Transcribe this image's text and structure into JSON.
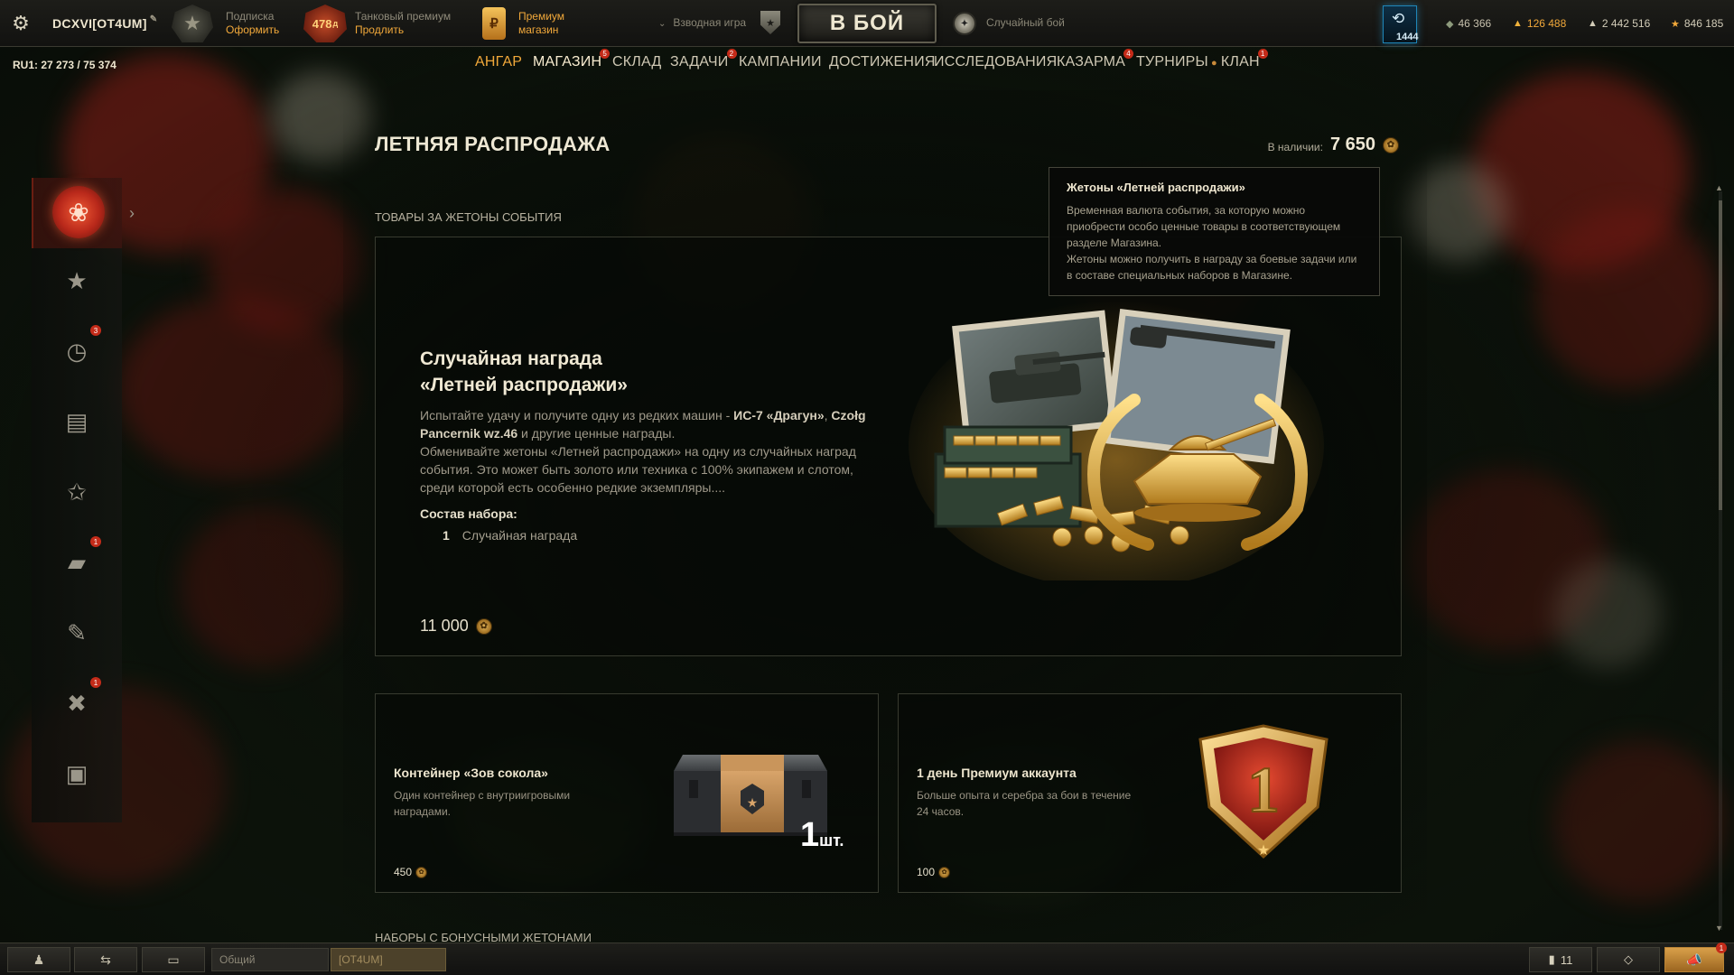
{
  "topbar": {
    "player_name": "DCXVI[OT4UM]",
    "subscription": {
      "line1": "Подписка",
      "line2": "Оформить"
    },
    "premium_tank": {
      "days": "478",
      "suffix": "д",
      "line1": "Танковый премиум",
      "line2": "Продлить"
    },
    "premium_shop": {
      "line1": "Премиум",
      "line2": "магазин"
    },
    "platoon_label": "Взводная игра",
    "battle_button": "В БОЙ",
    "battle_mode": "Случайный бой",
    "notifications_count": "1444",
    "currencies": [
      {
        "name": "bonds",
        "value": "46 366",
        "icon": "bond-icon"
      },
      {
        "name": "gold",
        "value": "126 488",
        "icon": "gold-icon"
      },
      {
        "name": "credits",
        "value": "2 442 516",
        "icon": "credits-icon"
      },
      {
        "name": "free_xp",
        "value": "846 185",
        "icon": "free-xp-icon"
      }
    ]
  },
  "server_online": {
    "server": "RU1:",
    "online": "27 273",
    "separator": "/",
    "total": "75 374"
  },
  "nav": [
    {
      "label": "АНГАР"
    },
    {
      "label": "МАГАЗИН",
      "badge": "5"
    },
    {
      "label": "СКЛАД"
    },
    {
      "label": "ЗАДАЧИ",
      "badge": "2"
    },
    {
      "label": "КАМПАНИИ"
    },
    {
      "label": "ДОСТИЖЕНИЯ"
    },
    {
      "label": "ИССЛЕДОВАНИЯ"
    },
    {
      "label": "КАЗАРМА",
      "badge": "4"
    },
    {
      "label": "ТУРНИРЫ"
    },
    {
      "label": "КЛАН",
      "badge": "1"
    }
  ],
  "sidebar": {
    "items": [
      {
        "icon": "summer-sale-icon"
      },
      {
        "icon": "star-icon"
      },
      {
        "icon": "clock-icon",
        "badge": "3"
      },
      {
        "icon": "bundles-icon"
      },
      {
        "icon": "premium-star-icon"
      },
      {
        "icon": "tank-icon",
        "badge": "1"
      },
      {
        "icon": "brush-icon"
      },
      {
        "icon": "tools-icon",
        "badge": "1"
      },
      {
        "icon": "money-icon"
      }
    ]
  },
  "page": {
    "title": "ЛЕТНЯЯ РАСПРОДАЖА",
    "balance_label": "В наличии:",
    "balance_value": "7 650",
    "section_label": "ТОВАРЫ ЗА ЖЕТОНЫ СОБЫТИЯ",
    "bottom_section_label": "НАБОРЫ С БОНУСНЫМИ ЖЕТОНАМИ"
  },
  "tooltip": {
    "title": "Жетоны «Летней распродажи»",
    "p1": "Временная валюта события, за которую можно приобрести особо ценные товары в соответствующем разделе Магазина.",
    "p2": "Жетоны можно получить в награду за боевые задачи или в составе специальных наборов в Магазине."
  },
  "main_offer": {
    "title_line1": "Случайная награда",
    "title_line2": "«Летней распродажи»",
    "desc_a": "Испытайте удачу и получите одну из редких машин - ",
    "desc_b1": "ИС-7 «Драгун»",
    "desc_c": ", ",
    "desc_b2": "Czołg Pancernik wz.46",
    "desc_d": " и другие ценные награды.",
    "desc_e": "Обменивайте жетоны «Летней распродажи» на одну из случайных наград события. Это может быть золото или техника с 100% экипажем и слотом, среди которой есть особенно редкие экземпляры....",
    "composition_title": "Состав набора:",
    "composition_qty": "1",
    "composition_item": "Случайная награда",
    "price": "11 000"
  },
  "offers": [
    {
      "title": "Контейнер «Зов сокола»",
      "desc": "Один контейнер с внутриигровыми наградами.",
      "price": "450",
      "count": "1",
      "count_suffix": "шт."
    },
    {
      "title": "1 день Премиум аккаунта",
      "desc": "Больше опыта и серебра за бои в течение 24 часов.",
      "price": "100",
      "badge_number": "1"
    }
  ],
  "bottombar": {
    "chat_channel": "Общий",
    "chat_clan": "[OT4UM]",
    "online_friends": "11",
    "notif_badge": "1"
  },
  "colors": {
    "accent_orange": "#f1a83a",
    "badge_red": "#c42b19",
    "text_primary": "#eee6cf",
    "text_secondary": "#9f998a"
  }
}
